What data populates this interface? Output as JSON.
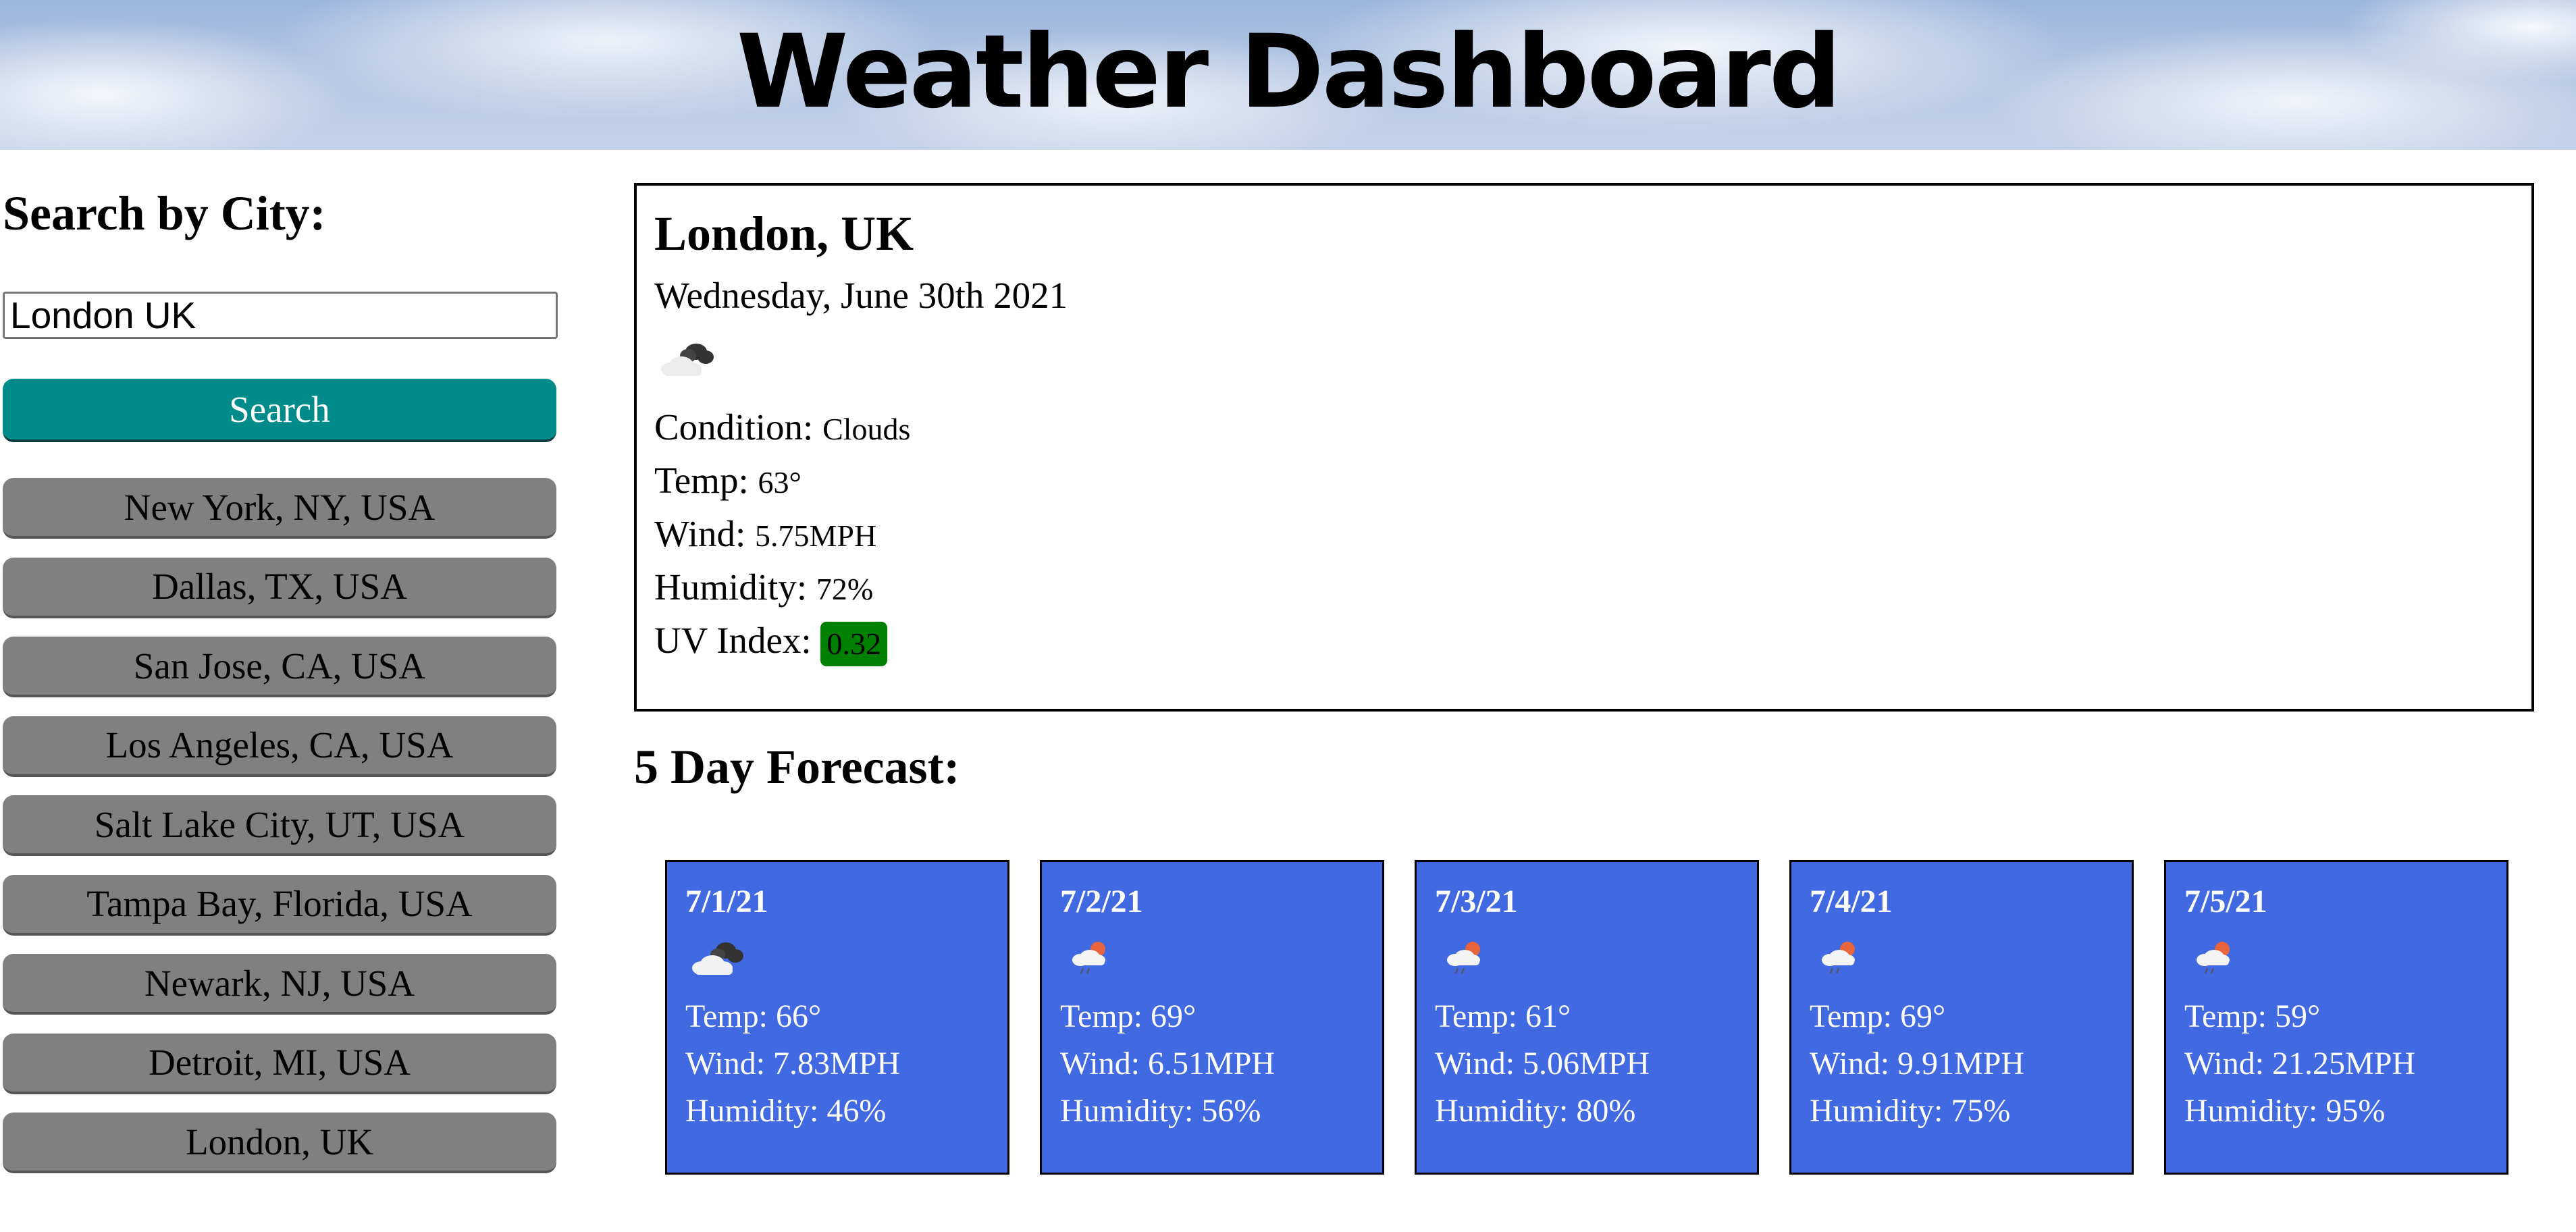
{
  "header": {
    "title": "Weather Dashboard"
  },
  "sidebar": {
    "heading": "Search by City:",
    "search_value": "London UK",
    "search_button": "Search",
    "history": [
      "New York, NY, USA",
      "Dallas, TX, USA",
      "San Jose, CA, USA",
      "Los Angeles, CA, USA",
      "Salt Lake City, UT, USA",
      "Tampa Bay, Florida, USA",
      "Newark, NJ, USA",
      "Detroit, MI, USA",
      "London, UK"
    ]
  },
  "current": {
    "city": "London, UK",
    "date": "Wednesday, June 30th 2021",
    "icon": "clouds-icon",
    "condition_label": "Condition:",
    "condition": "Clouds",
    "temp_label": "Temp:",
    "temp": "63°",
    "wind_label": "Wind:",
    "wind": "5.75MPH",
    "humidity_label": "Humidity:",
    "humidity": "72%",
    "uv_label": "UV Index:",
    "uv": "0.32",
    "uv_color": "#008000"
  },
  "forecast": {
    "title": "5 Day Forecast:",
    "days": [
      {
        "date": "7/1/21",
        "icon": "broken-clouds-icon",
        "temp": "Temp: 66°",
        "wind": "Wind: 7.83MPH",
        "humidity": "Humidity: 46%"
      },
      {
        "date": "7/2/21",
        "icon": "rain-icon",
        "temp": "Temp: 69°",
        "wind": "Wind: 6.51MPH",
        "humidity": "Humidity: 56%"
      },
      {
        "date": "7/3/21",
        "icon": "rain-icon",
        "temp": "Temp: 61°",
        "wind": "Wind: 5.06MPH",
        "humidity": "Humidity: 80%"
      },
      {
        "date": "7/4/21",
        "icon": "rain-icon",
        "temp": "Temp: 69°",
        "wind": "Wind: 9.91MPH",
        "humidity": "Humidity: 75%"
      },
      {
        "date": "7/5/21",
        "icon": "rain-icon",
        "temp": "Temp: 59°",
        "wind": "Wind: 21.25MPH",
        "humidity": "Humidity: 95%"
      }
    ]
  },
  "colors": {
    "search_button": "#008b8b",
    "history_button": "#808080",
    "forecast_card": "#4169e1"
  }
}
